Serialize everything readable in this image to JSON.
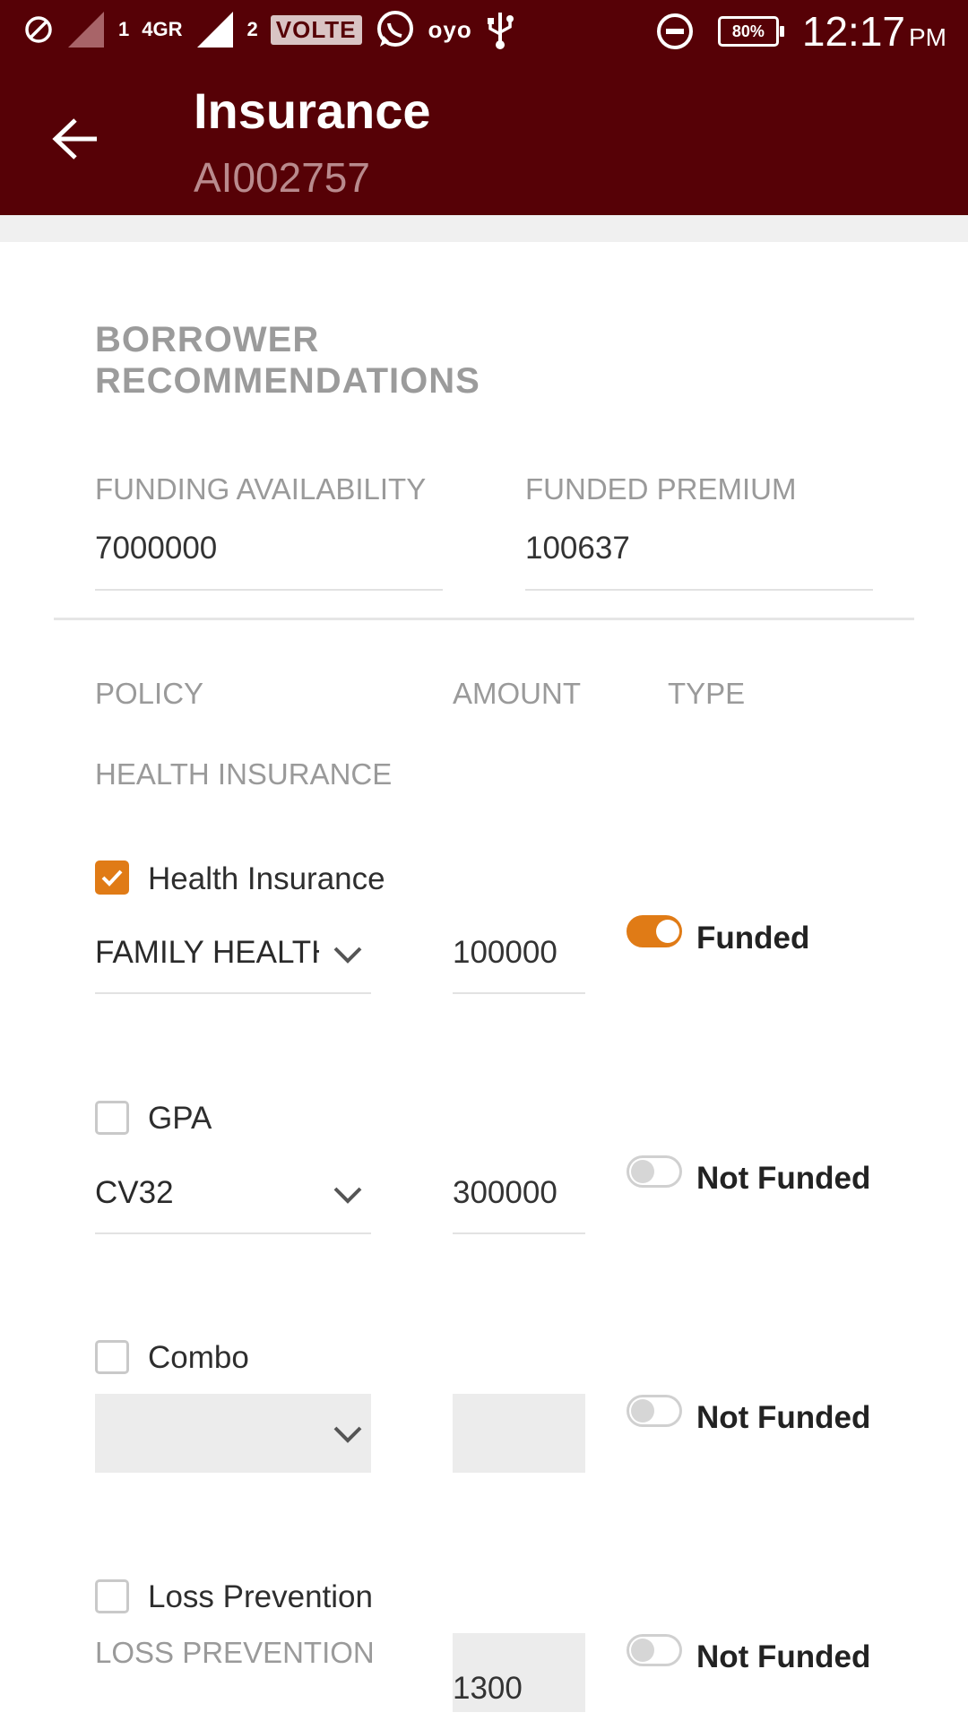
{
  "status_bar": {
    "network_type": "4GR",
    "sim1": "1",
    "sim2": "2",
    "volte": "VOLTE",
    "oyo": "oyo",
    "battery": "80%",
    "time": "12:17",
    "ampm": "PM",
    "icons": [
      "block-icon",
      "signal-icon",
      "whatsapp-icon",
      "usb-icon",
      "dnd-icon",
      "battery-icon"
    ]
  },
  "appbar": {
    "title": "Insurance",
    "subtitle": "AI002757",
    "back_icon": "arrow-left-icon"
  },
  "section": {
    "title_line1": "BORROWER",
    "title_line2": "RECOMMENDATIONS"
  },
  "funding": {
    "availability_label": "FUNDING AVAILABILITY",
    "availability_value": "7000000",
    "premium_label": "FUNDED PREMIUM",
    "premium_value": "100637"
  },
  "columns": {
    "policy": "POLICY",
    "amount": "AMOUNT",
    "type": "TYPE"
  },
  "group_label": "HEALTH INSURANCE",
  "policies": [
    {
      "name": "Health Insurance",
      "checked": true,
      "select_value": "FAMILY HEALTH",
      "amount": "100000",
      "type_label": "Funded",
      "funded": true
    },
    {
      "name": "GPA",
      "checked": false,
      "select_value": "CV32",
      "amount": "300000",
      "type_label": "Not Funded",
      "funded": false
    },
    {
      "name": "Combo",
      "checked": false,
      "select_value": "",
      "amount": "",
      "type_label": "Not Funded",
      "funded": false
    },
    {
      "name": "Loss Prevention",
      "checked": false,
      "sub_label": "LOSS PREVENTION",
      "amount": "1300",
      "type_label": "Not Funded",
      "funded": false
    }
  ],
  "colors": {
    "primary": "#560106",
    "accent": "#e07b16",
    "label_gray": "#9a9a9a"
  }
}
